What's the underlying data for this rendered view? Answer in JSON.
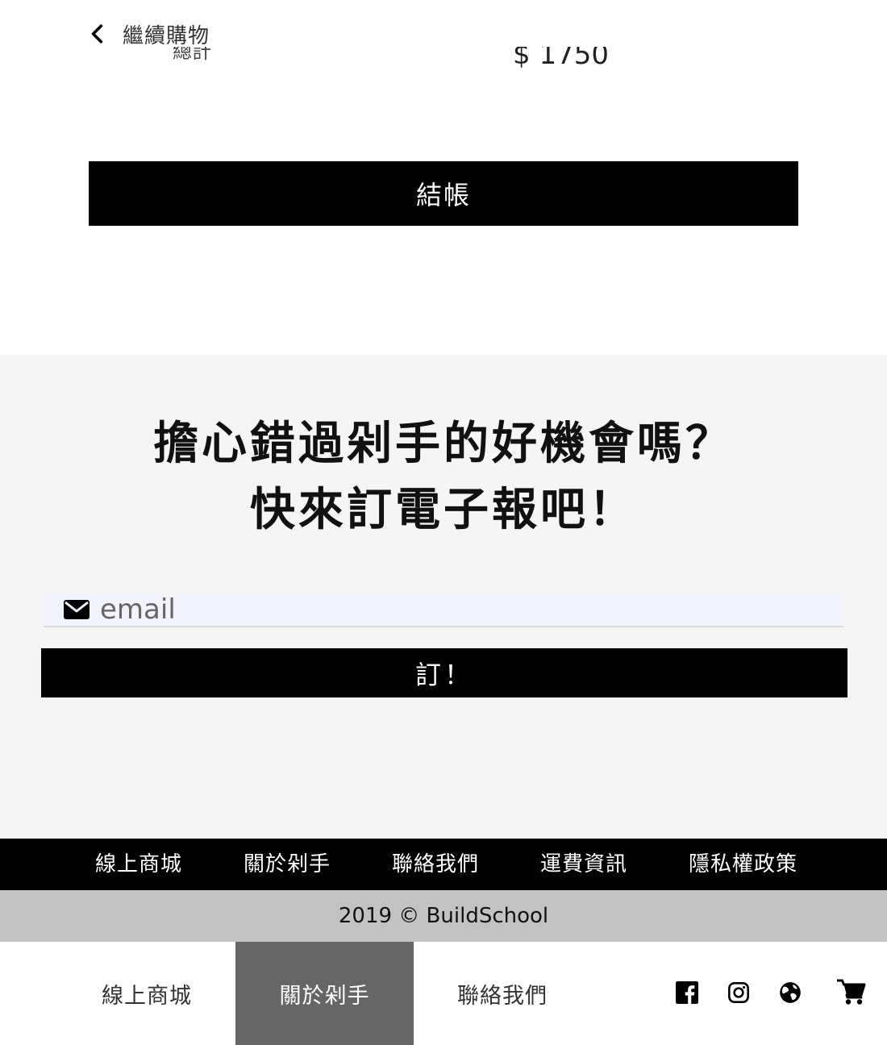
{
  "cart": {
    "back_label": "繼續購物",
    "total_label": "總計",
    "total_value": "$ 1750",
    "checkout_label": "結帳"
  },
  "newsletter": {
    "headline_line1": "擔心錯過剁手的好機會嗎？",
    "headline_line2": "快來訂電子報吧！",
    "email_placeholder": "email",
    "subscribe_label": "訂！"
  },
  "footer": {
    "links": [
      "線上商城",
      "關於剁手",
      "聯絡我們",
      "運費資訊",
      "隱私權政策"
    ],
    "copyright": "2019 © BuildSchool"
  },
  "bottom_nav": {
    "items": [
      "線上商城",
      "關於剁手",
      "聯絡我們"
    ],
    "active_index": 1,
    "icons": [
      "facebook-icon",
      "instagram-icon",
      "globe-icon",
      "cart-icon"
    ]
  },
  "colors": {
    "primary": "#000000",
    "newsletter_bg": "#f5f5f5",
    "copyright_bg": "#c2c2c2",
    "active_nav_bg": "#666666",
    "email_bg": "#f2f3fc"
  }
}
